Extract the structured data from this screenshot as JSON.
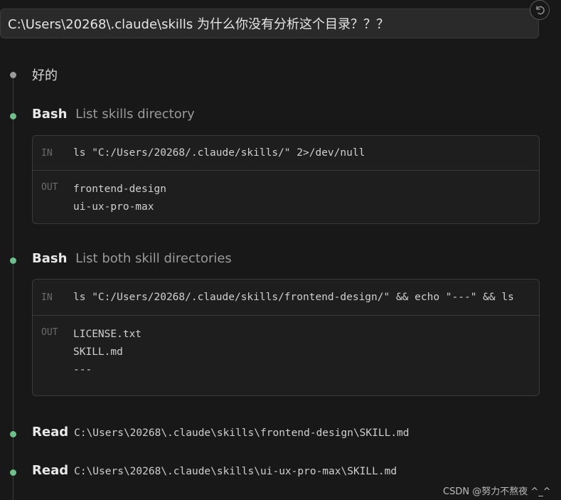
{
  "prompt": {
    "text": "C:\\Users\\20268\\.claude\\skills  为什么你没有分析这个目录？？？"
  },
  "undo_icon": "undo-icon",
  "steps": [
    {
      "type": "text",
      "text": "好的"
    },
    {
      "type": "bash",
      "tool": "Bash",
      "desc": "List skills directory",
      "in_label": "IN",
      "command": "ls \"C:/Users/20268/.claude/skills/\" 2>/dev/null",
      "out_label": "OUT",
      "output": [
        "frontend-design",
        "ui-ux-pro-max"
      ]
    },
    {
      "type": "bash",
      "tool": "Bash",
      "desc": "List both skill directories",
      "in_label": "IN",
      "command": "ls \"C:/Users/20268/.claude/skills/frontend-design/\" && echo \"---\" && ls",
      "out_label": "OUT",
      "output": [
        "LICENSE.txt",
        "SKILL.md",
        "---"
      ]
    },
    {
      "type": "read",
      "tool": "Read",
      "path": "C:\\Users\\20268\\.claude\\skills\\frontend-design\\SKILL.md"
    },
    {
      "type": "read",
      "tool": "Read",
      "path": "C:\\Users\\20268\\.claude\\skills\\ui-ux-pro-max\\SKILL.md"
    }
  ],
  "watermark": "CSDN @努力不熬夜 ^_^",
  "colors": {
    "background": "#181818",
    "dot_done": "#6fbf8a",
    "dot_neutral": "#9a9a9a"
  }
}
